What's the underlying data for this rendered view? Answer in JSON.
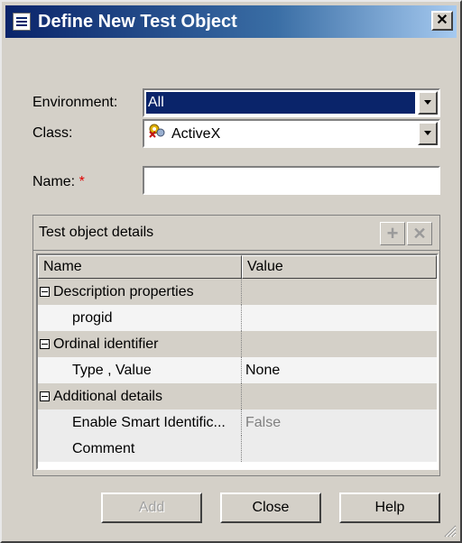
{
  "window": {
    "title": "Define New Test Object",
    "close_glyph": "✕"
  },
  "form": {
    "environment_label": "Environment:",
    "environment_value": "All",
    "class_label": "Class:",
    "class_value": "ActiveX",
    "class_icon": "activex-icon",
    "name_label": "Name:",
    "name_required_mark": "*",
    "name_value": ""
  },
  "details": {
    "title": "Test object details",
    "add_glyph": "+",
    "remove_glyph": "✕",
    "columns": [
      "Name",
      "Value"
    ],
    "rows": [
      {
        "type": "category",
        "name": "Description properties",
        "value": ""
      },
      {
        "type": "property",
        "name": "progid",
        "value": ""
      },
      {
        "type": "category",
        "name": "Ordinal identifier",
        "value": ""
      },
      {
        "type": "property",
        "name": "Type , Value",
        "value": "None"
      },
      {
        "type": "category",
        "name": "Additional details",
        "value": ""
      },
      {
        "type": "property",
        "name": "Enable Smart Identific...",
        "value": "False"
      },
      {
        "type": "property",
        "name": "Comment",
        "value": ""
      }
    ]
  },
  "buttons": {
    "add": "Add",
    "close": "Close",
    "help": "Help"
  },
  "colors": {
    "titlebar": "#0a246a",
    "dialog_bg": "#d4d0c8",
    "required": "#e00000"
  }
}
